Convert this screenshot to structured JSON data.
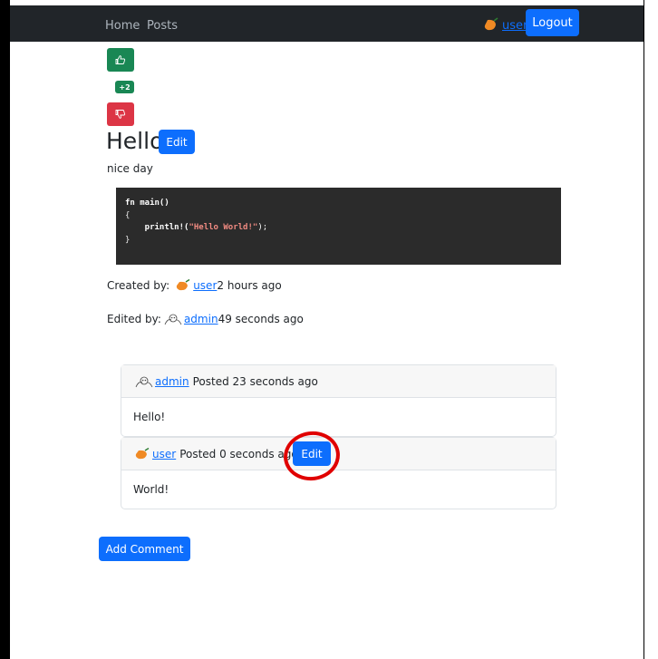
{
  "navbar": {
    "home_label": "Home",
    "posts_label": "Posts",
    "user_label": "user",
    "logout_label": "Logout"
  },
  "votes": {
    "score": "+2",
    "upvote_icon": "thumbs-up-icon",
    "downvote_icon": "thumbs-down-icon"
  },
  "post": {
    "title": "Hello",
    "edit_label": "Edit",
    "body": "nice day",
    "code_lines": [
      "fn main()",
      "{",
      "    println!(\"Hello World!\");",
      "}"
    ],
    "created_by_label": "Created by:",
    "created_user": "user",
    "created_time": "2 hours ago",
    "edited_by_label": "Edited by:",
    "edited_user": "admin",
    "edited_time": "49 seconds ago"
  },
  "comments": [
    {
      "author": "admin",
      "posted_text": "Posted 23 seconds ago",
      "body": "Hello!"
    },
    {
      "author": "user",
      "posted_text": "Posted 0 seconds ago",
      "body": "World!",
      "edit_label": "Edit"
    }
  ],
  "add_comment_label": "Add Comment",
  "colors": {
    "navbar_bg": "#212529",
    "primary": "#0d6efd",
    "success": "#198754",
    "danger": "#dc3545",
    "annotation": "#e00000"
  }
}
